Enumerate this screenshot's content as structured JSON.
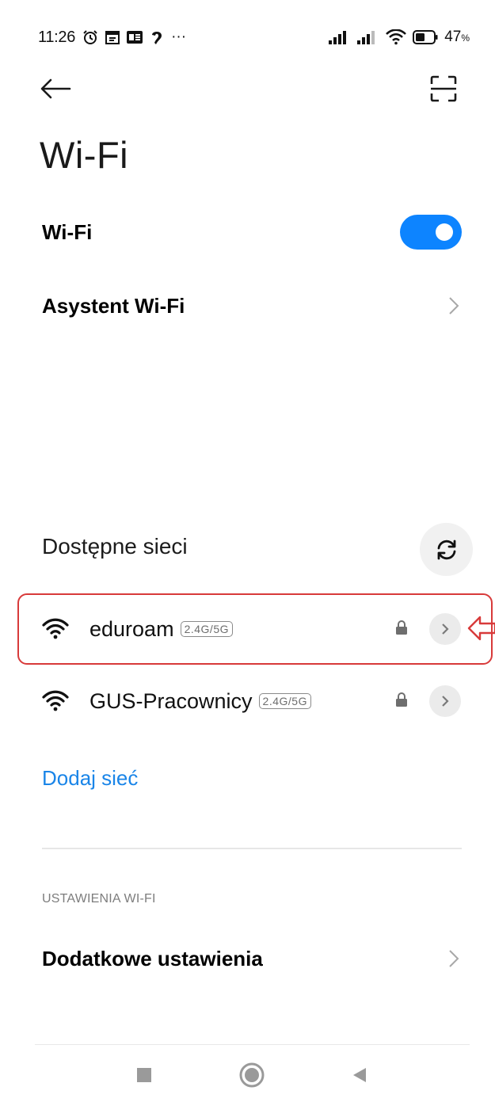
{
  "status_bar": {
    "time": "11:26",
    "more": "···",
    "battery_percent": "47",
    "percent_sign": "%"
  },
  "page": {
    "title": "Wi-Fi"
  },
  "wifi_toggle": {
    "label": "Wi-Fi",
    "enabled": true
  },
  "assistant": {
    "label": "Asystent Wi-Fi"
  },
  "available": {
    "title": "Dostępne sieci",
    "networks": [
      {
        "name": "eduroam",
        "band": "2.4G/5G",
        "secured": true,
        "highlighted": true
      },
      {
        "name": "GUS-Pracownicy",
        "band": "2.4G/5G",
        "secured": true,
        "highlighted": false
      }
    ],
    "add_network": "Dodaj sieć"
  },
  "settings": {
    "header": "USTAWIENIA WI-FI",
    "additional": "Dodatkowe ustawienia"
  },
  "colors": {
    "accent": "#0d84ff",
    "link": "#1a85e8",
    "annotation": "#d83a3a"
  }
}
